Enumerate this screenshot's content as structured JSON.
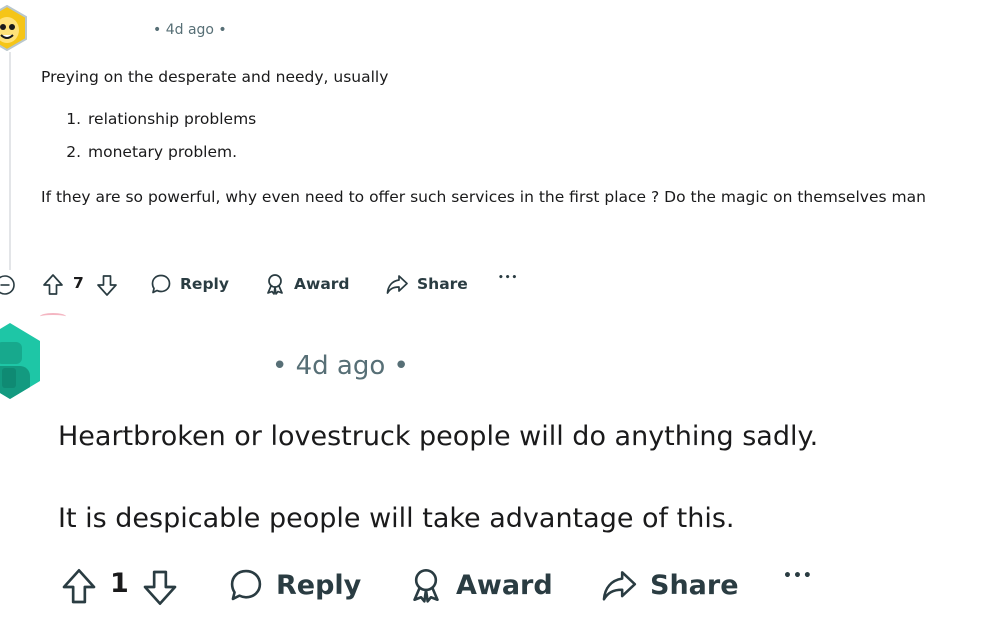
{
  "comments": [
    {
      "time_text": "• 4d ago •",
      "body": {
        "intro": "Preying on the desperate and needy, usually",
        "list": [
          "relationship problems",
          "monetary problem."
        ],
        "outro": "If they are so powerful, why even need to offer such services in the first place ? Do the magic on themselves man"
      },
      "score": "7",
      "actions": {
        "reply": "Reply",
        "award": "Award",
        "share": "Share",
        "more": "•••"
      },
      "avatar_color": "#f5c518"
    },
    {
      "time_text": "• 4d ago •",
      "body": {
        "p1": "Heartbroken or lovestruck people will do anything sadly.",
        "p2": "It is despicable people will take advantage of this."
      },
      "score": "1",
      "actions": {
        "reply": "Reply",
        "award": "Award",
        "share": "Share",
        "more": "•••"
      },
      "avatar_color": "#1ec6a6"
    }
  ],
  "icons": {
    "upvote": "arrow-up-outline-icon",
    "downvote": "arrow-down-outline-icon",
    "reply": "speech-bubble-icon",
    "award": "award-ribbon-icon",
    "share": "share-arrow-icon",
    "more": "ellipsis-icon",
    "collapse": "minus-circle-icon"
  }
}
